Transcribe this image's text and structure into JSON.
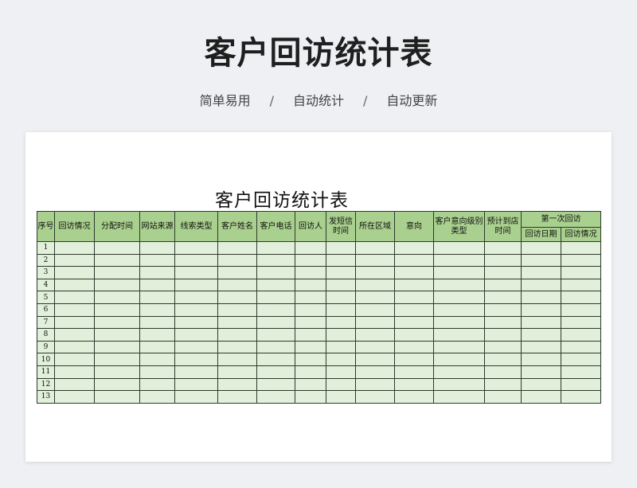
{
  "header": {
    "title": "客户回访统计表",
    "tags": [
      "简单易用",
      "自动统计",
      "自动更新"
    ],
    "separator": "/"
  },
  "sheet": {
    "title": "客户回访统计表",
    "columns": [
      "序号",
      "回访情况",
      "分配时间",
      "网站来源",
      "线索类型",
      "客户姓名",
      "客户电话",
      "回访人",
      "发短信时间",
      "所在区域",
      "意向",
      "客户意向级别类型",
      "预计到店时间"
    ],
    "group_header": "第一次回访",
    "sub_columns": [
      "回访日期",
      "回访情况"
    ],
    "row_numbers": [
      "1",
      "2",
      "3",
      "4",
      "5",
      "6",
      "7",
      "8",
      "9",
      "10",
      "11",
      "12",
      "13"
    ]
  },
  "colors": {
    "header_fill": "#a9d08e",
    "cell_fill": "#e2efda",
    "border": "#2d3a2d"
  }
}
